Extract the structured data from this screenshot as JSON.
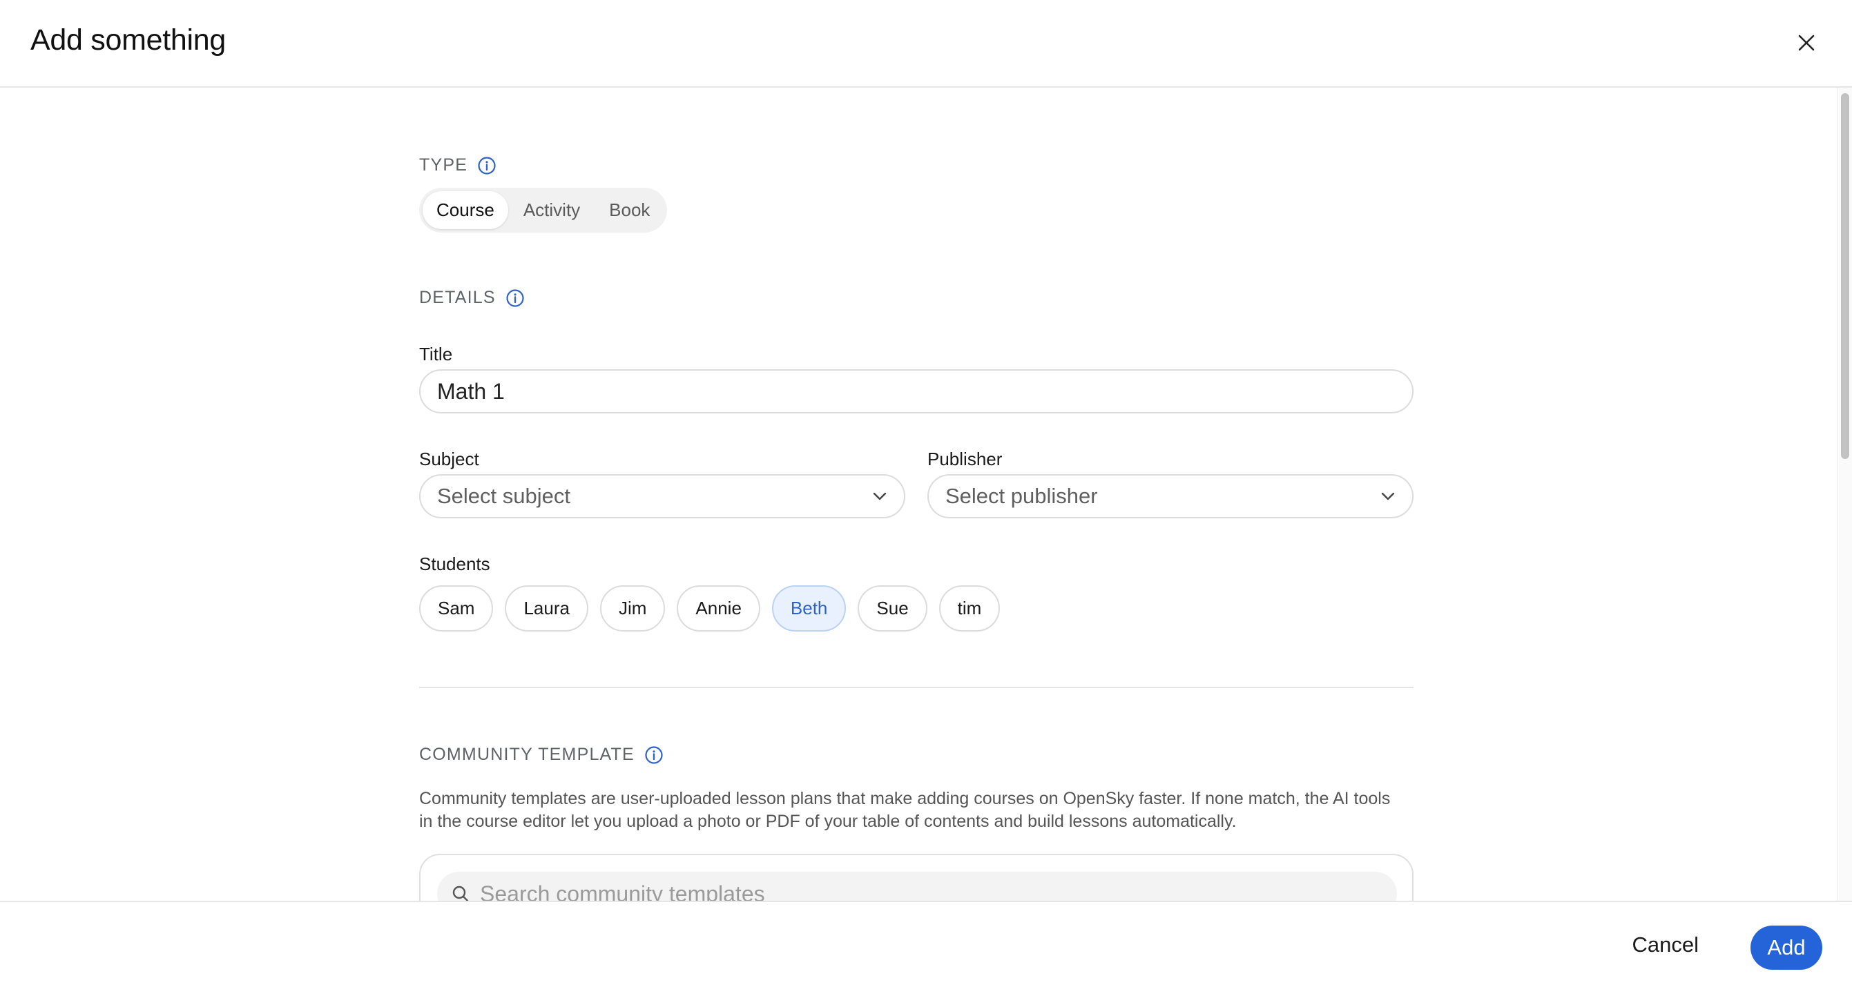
{
  "header": {
    "title": "Add something"
  },
  "type_section": {
    "label": "TYPE",
    "options": [
      {
        "label": "Course",
        "active": true
      },
      {
        "label": "Activity",
        "active": false
      },
      {
        "label": "Book",
        "active": false
      }
    ]
  },
  "details_section": {
    "label": "DETAILS",
    "title_label": "Title",
    "title_value": "Math 1",
    "subject_label": "Subject",
    "subject_placeholder": "Select subject",
    "publisher_label": "Publisher",
    "publisher_placeholder": "Select publisher",
    "students_label": "Students",
    "students": [
      {
        "name": "Sam",
        "selected": false
      },
      {
        "name": "Laura",
        "selected": false
      },
      {
        "name": "Jim",
        "selected": false
      },
      {
        "name": "Annie",
        "selected": false
      },
      {
        "name": "Beth",
        "selected": true
      },
      {
        "name": "Sue",
        "selected": false
      },
      {
        "name": "tim",
        "selected": false
      }
    ]
  },
  "community_section": {
    "label": "COMMUNITY TEMPLATE",
    "description_line1": "Community templates are user-uploaded lesson plans that make adding courses on OpenSky faster. If none match, the AI tools",
    "description_line2": "in the course editor let you upload a photo or PDF of your table of contents and build lessons automatically.",
    "search_placeholder": "Search community templates"
  },
  "footer": {
    "cancel_label": "Cancel",
    "add_label": "Add"
  },
  "colors": {
    "accent": "#2563d9",
    "info_icon": "#2f63c9",
    "selected_chip_bg": "#e8f1fd"
  },
  "icons": {
    "close": "close-icon",
    "info": "info-icon",
    "chevron": "chevron-down-icon",
    "search": "search-icon"
  }
}
